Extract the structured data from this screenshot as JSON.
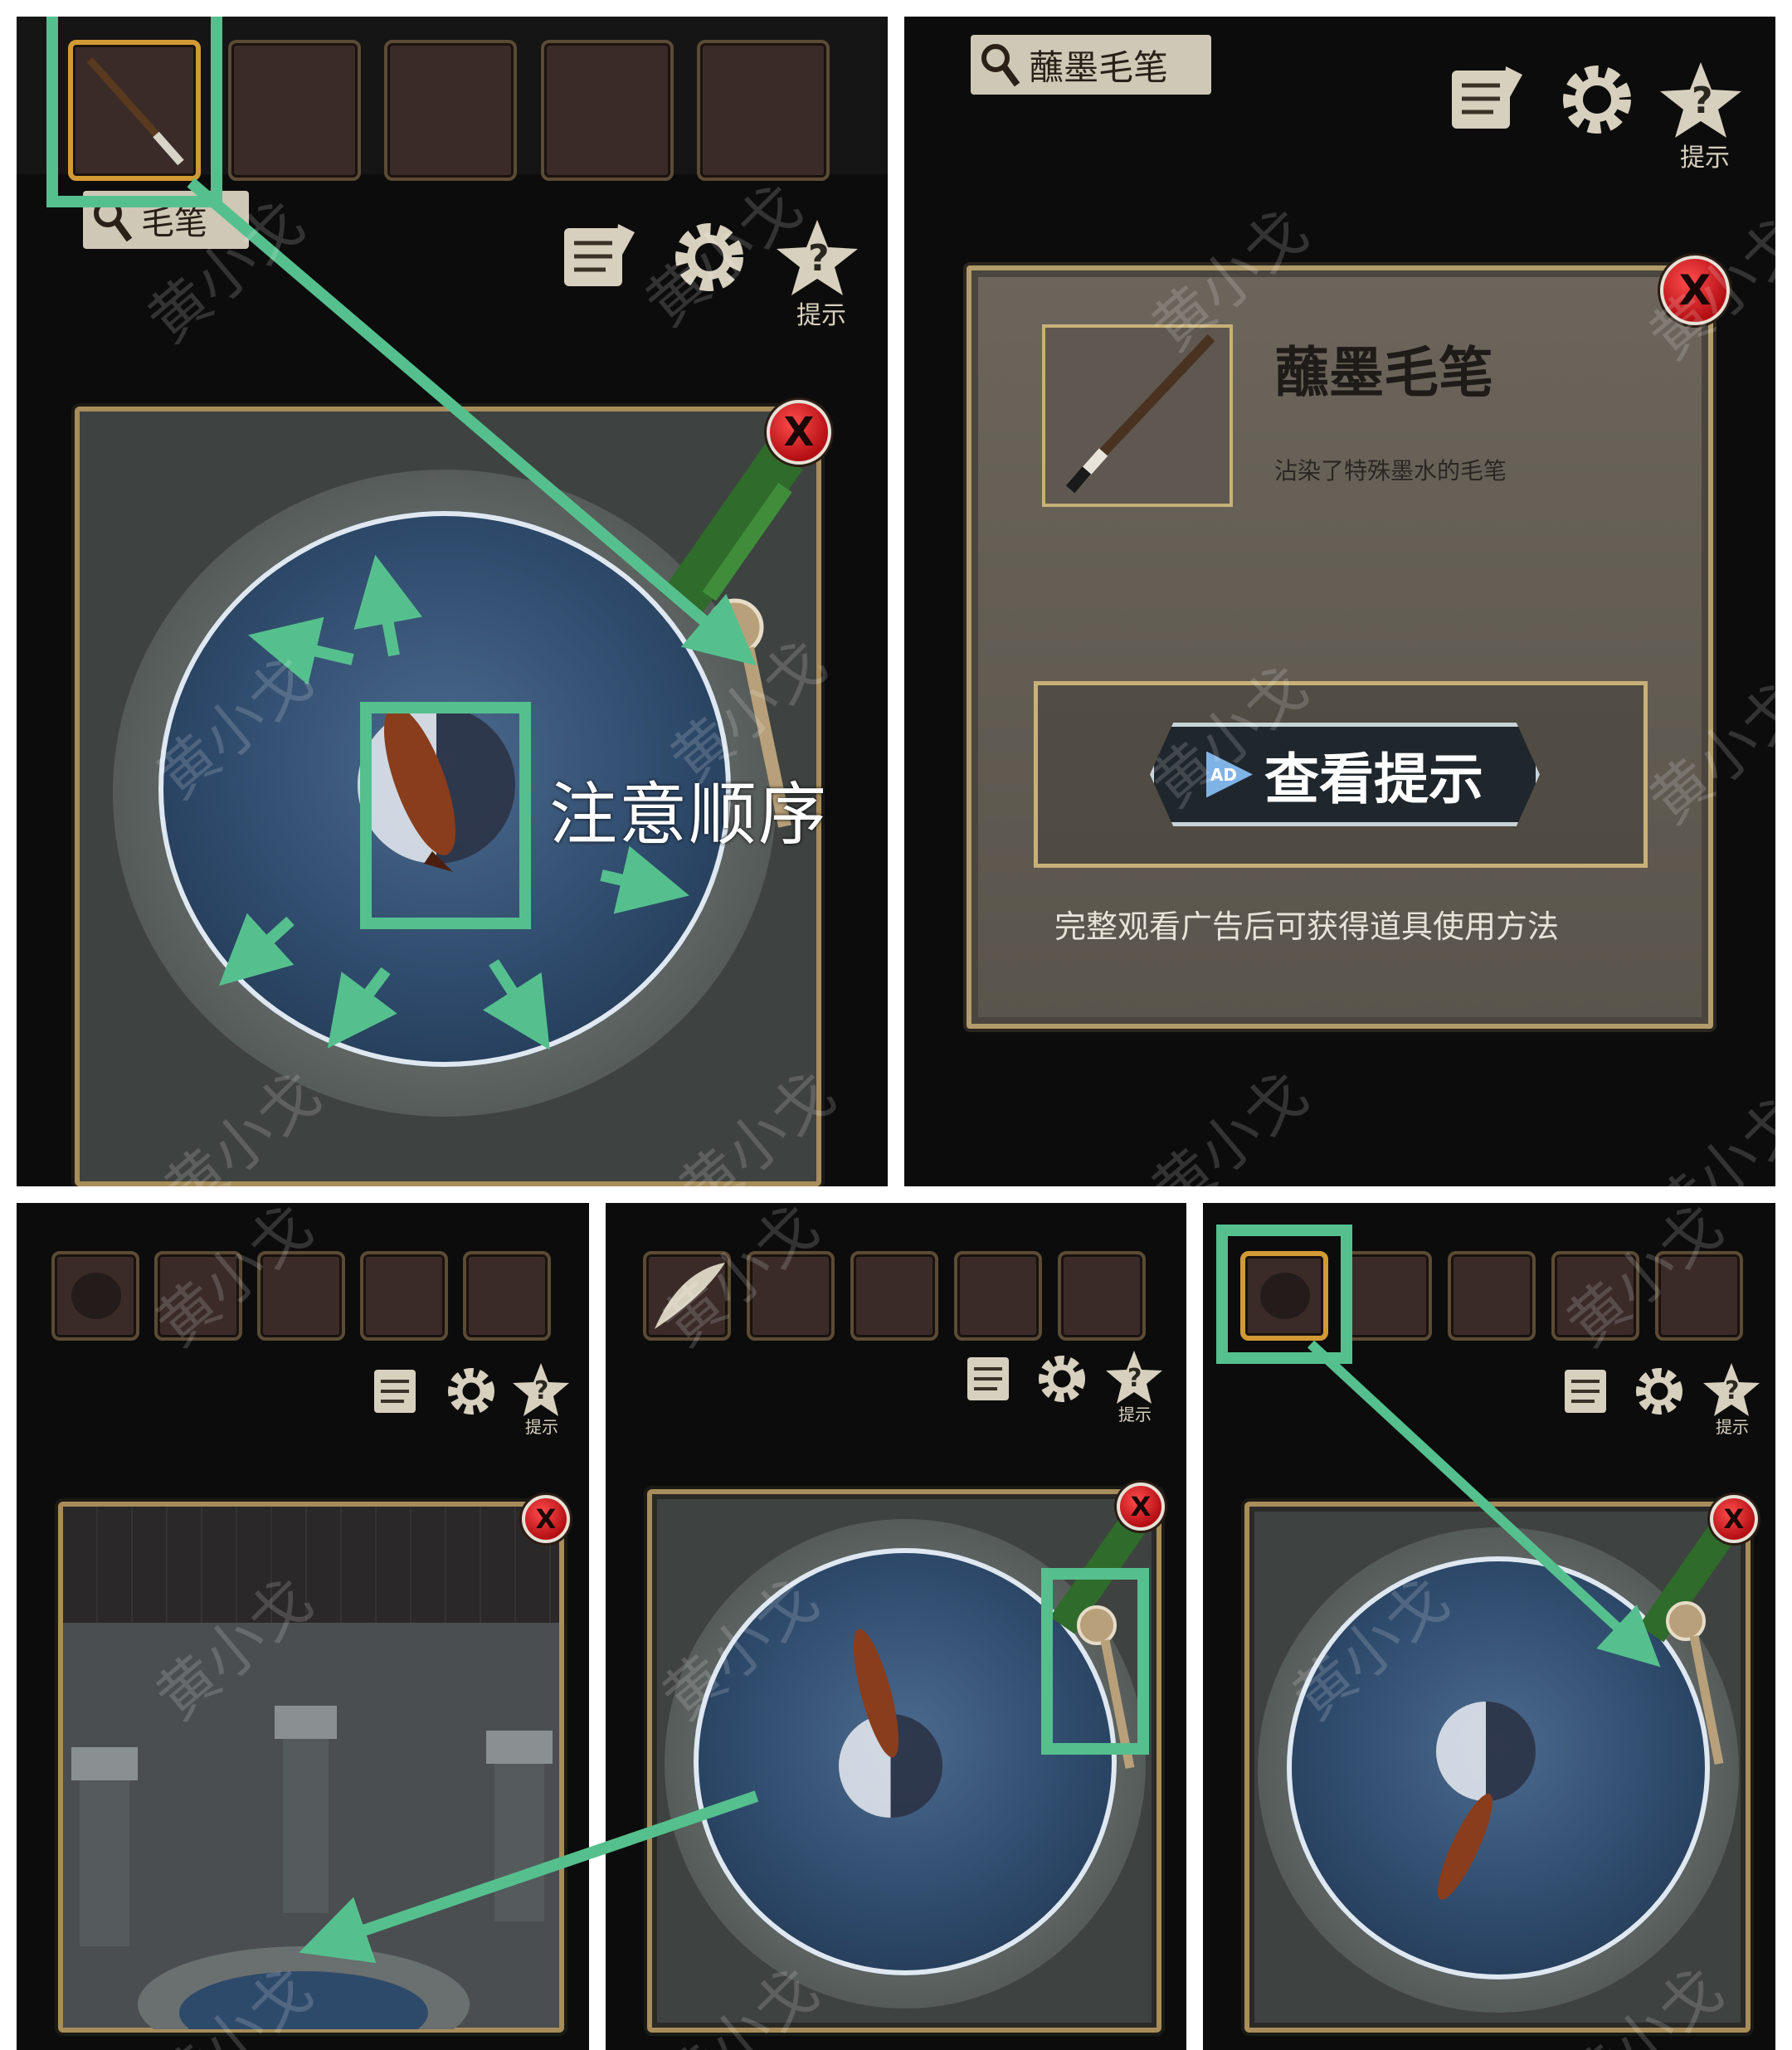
{
  "panels": {
    "top_left": {
      "selected_item_label": "毛笔",
      "annotation": "注意顺序",
      "hint_icon_caption": "提示"
    },
    "top_right": {
      "selected_item_label": "蘸墨毛笔",
      "hint_icon_caption": "提示",
      "detail": {
        "title": "蘸墨毛笔",
        "description": "沾染了特殊墨水的毛笔",
        "hint_button_badge": "AD",
        "hint_button_label": "查看提示",
        "hint_note": "完整观看广告后可获得道具使用方法"
      }
    },
    "bottom_left": {
      "hint_icon_caption": "提示"
    },
    "bottom_middle": {
      "hint_icon_caption": "提示"
    },
    "bottom_right": {
      "hint_icon_caption": "提示"
    }
  },
  "close_glyph": "X",
  "watermark": "黄小戈",
  "colors": {
    "annotation_green": "#55c08e",
    "selected_slot": "#d29a35",
    "close_red": "#c8151b"
  },
  "icons": [
    "notes-scroll-icon",
    "gear-icon",
    "hint-star-icon",
    "magnifier-icon",
    "close-icon",
    "ad-play-icon"
  ]
}
